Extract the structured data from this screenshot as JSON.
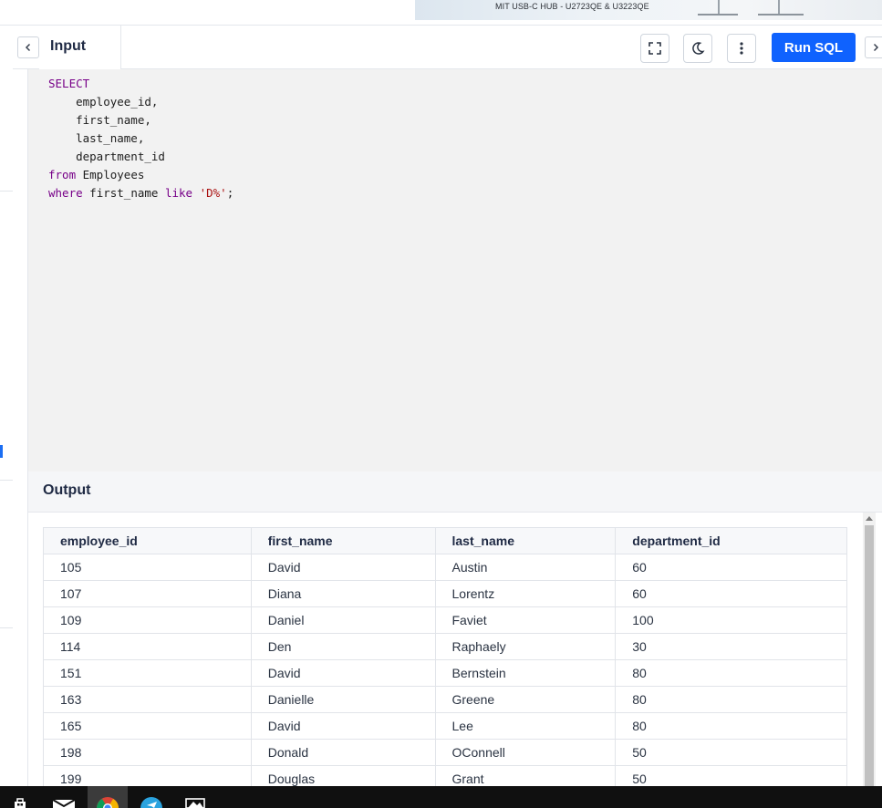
{
  "ad_banner": {
    "text": "MIT USB-C HUB - U2723QE & U3223QE"
  },
  "header": {
    "back_icon": "chevron-left-icon",
    "tab_label": "Input",
    "fullscreen_icon": "fullscreen-icon",
    "theme_icon": "moon-icon",
    "menu_icon": "vertical-dots-icon",
    "run_label": "Run SQL",
    "forward_icon": "chevron-right-icon",
    "accent_color": "#0f62fe"
  },
  "editor": {
    "lines": [
      [
        {
          "t": "SELECT",
          "c": "kw"
        }
      ],
      [
        {
          "t": "    employee_id,",
          "c": ""
        }
      ],
      [
        {
          "t": "    first_name,",
          "c": ""
        }
      ],
      [
        {
          "t": "    last_name,",
          "c": ""
        }
      ],
      [
        {
          "t": "    department_id",
          "c": ""
        }
      ],
      [
        {
          "t": "from",
          "c": "kw"
        },
        {
          "t": " Employees",
          "c": ""
        }
      ],
      [
        {
          "t": "where",
          "c": "kw"
        },
        {
          "t": " first_name ",
          "c": ""
        },
        {
          "t": "like",
          "c": "kw"
        },
        {
          "t": " ",
          "c": ""
        },
        {
          "t": "'D%'",
          "c": "str"
        },
        {
          "t": ";",
          "c": ""
        }
      ]
    ]
  },
  "output": {
    "title": "Output",
    "columns": [
      "employee_id",
      "first_name",
      "last_name",
      "department_id"
    ],
    "rows": [
      [
        "105",
        "David",
        "Austin",
        "60"
      ],
      [
        "107",
        "Diana",
        "Lorentz",
        "60"
      ],
      [
        "109",
        "Daniel",
        "Faviet",
        "100"
      ],
      [
        "114",
        "Den",
        "Raphaely",
        "30"
      ],
      [
        "151",
        "David",
        "Bernstein",
        "80"
      ],
      [
        "163",
        "Danielle",
        "Greene",
        "80"
      ],
      [
        "165",
        "David",
        "Lee",
        "80"
      ],
      [
        "198",
        "Donald",
        "OConnell",
        "50"
      ],
      [
        "199",
        "Douglas",
        "Grant",
        "50"
      ]
    ]
  },
  "taskbar": {
    "items": [
      "store-icon",
      "mail-icon",
      "chrome-icon",
      "telegram-icon",
      "photos-icon"
    ],
    "active": "chrome-icon"
  }
}
